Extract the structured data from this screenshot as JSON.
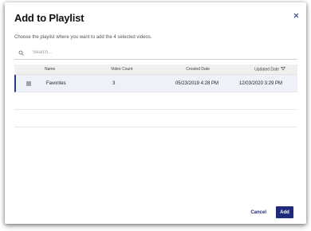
{
  "dialog": {
    "title": "Add to Playlist",
    "close_icon": "close-icon",
    "subtitle": "Choose the playlist where you want to add the 4 selected videos."
  },
  "search": {
    "icon": "search-icon",
    "placeholder": "Search..."
  },
  "table": {
    "columns": {
      "name": "Name",
      "video_count": "Video Count",
      "created_date": "Created Date",
      "updated_date": "Updated Date",
      "sort_icon": "sort-descending-icon"
    },
    "rows": [
      {
        "name": "Favorites",
        "video_count": "3",
        "created_date": "05/23/2019 4:28 PM",
        "updated_date": "12/03/2020 3:29 PM",
        "selected": true
      }
    ]
  },
  "footer": {
    "cancel_label": "Cancel",
    "add_label": "Add"
  },
  "colors": {
    "accent": "#1f2b7a",
    "selected_row": "#eef1f8",
    "header_bg": "#f0f0f0"
  }
}
